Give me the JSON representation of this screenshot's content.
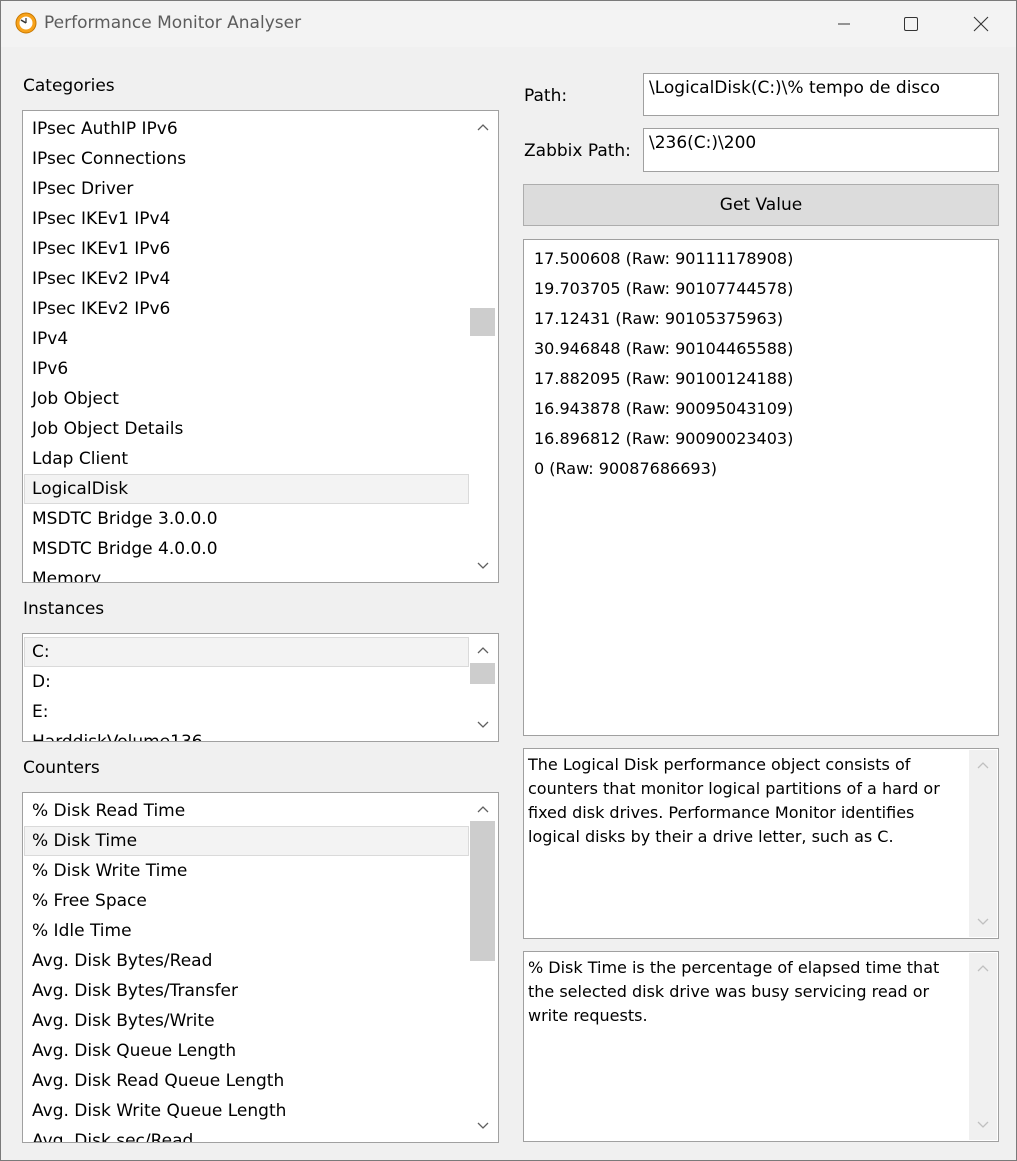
{
  "window": {
    "title": "Performance Monitor Analyser",
    "controls": [
      "minimize",
      "maximize",
      "close"
    ]
  },
  "categories": {
    "label": "Categories",
    "items": [
      "IPsec AuthIP IPv6",
      "IPsec Connections",
      "IPsec Driver",
      "IPsec IKEv1 IPv4",
      "IPsec IKEv1 IPv6",
      "IPsec IKEv2 IPv4",
      "IPsec IKEv2 IPv6",
      "IPv4",
      "IPv6",
      "Job Object",
      "Job Object Details",
      "Ldap Client",
      "LogicalDisk",
      "MSDTC Bridge 3.0.0.0",
      "MSDTC Bridge 4.0.0.0",
      "Memory"
    ],
    "selected": "LogicalDisk"
  },
  "instances": {
    "label": "Instances",
    "items": [
      "C:",
      "D:",
      "E:",
      "HarddiskVolume136"
    ],
    "selected": "C:"
  },
  "counters": {
    "label": "Counters",
    "items": [
      "% Disk Read Time",
      "% Disk Time",
      "% Disk Write Time",
      "% Free Space",
      "% Idle Time",
      "Avg. Disk Bytes/Read",
      "Avg. Disk Bytes/Transfer",
      "Avg. Disk Bytes/Write",
      "Avg. Disk Queue Length",
      "Avg. Disk Read Queue Length",
      "Avg. Disk Write Queue Length",
      "Avg. Disk sec/Read"
    ],
    "selected": "% Disk Time"
  },
  "path": {
    "label": "Path:",
    "value": "\\LogicalDisk(C:)\\% tempo de disco"
  },
  "zabbix_path": {
    "label": "Zabbix Path:",
    "value": "\\236(C:)\\200"
  },
  "get_value_button": "Get Value",
  "results": [
    "17.500608 (Raw: 90111178908)",
    "19.703705 (Raw: 90107744578)",
    "17.12431 (Raw: 90105375963)",
    "30.946848 (Raw: 90104465588)",
    "17.882095 (Raw: 90100124188)",
    "16.943878 (Raw: 90095043109)",
    "16.896812 (Raw: 90090023403)",
    "0 (Raw: 90087686693)"
  ],
  "category_description": "The Logical Disk performance object consists of counters that monitor logical partitions of a hard or fixed disk drives.  Performance Monitor identifies logical disks by their a drive letter, such as C.",
  "counter_description": "% Disk Time is the percentage of elapsed time that the selected disk drive was busy servicing read or write requests."
}
